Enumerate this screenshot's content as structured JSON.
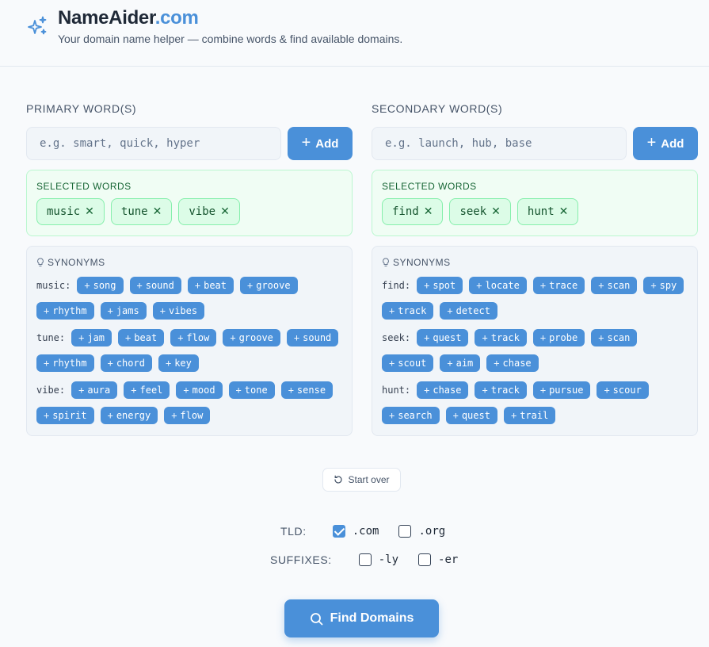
{
  "header": {
    "brand_name": "NameAider",
    "brand_tld": ".com",
    "tagline": "Your domain name helper — combine words & find available domains.",
    "logo_icon": "sparkles-icon"
  },
  "primary": {
    "label": "PRIMARY WORD(S)",
    "placeholder": "e.g. smart, quick, hyper",
    "add_label": "Add",
    "selected_label": "SELECTED WORDS",
    "selected": [
      "music",
      "tune",
      "vibe"
    ],
    "synonyms_label": "SYNONYMS",
    "synonyms": [
      {
        "key": "music:",
        "words": [
          "song",
          "sound",
          "beat",
          "groove",
          "rhythm",
          "jams",
          "vibes"
        ]
      },
      {
        "key": "tune:",
        "words": [
          "jam",
          "beat",
          "flow",
          "groove",
          "sound",
          "rhythm",
          "chord",
          "key"
        ]
      },
      {
        "key": "vibe:",
        "words": [
          "aura",
          "feel",
          "mood",
          "tone",
          "sense",
          "spirit",
          "energy",
          "flow"
        ]
      }
    ]
  },
  "secondary": {
    "label": "SECONDARY WORD(S)",
    "placeholder": "e.g. launch, hub, base",
    "add_label": "Add",
    "selected_label": "SELECTED WORDS",
    "selected": [
      "find",
      "seek",
      "hunt"
    ],
    "synonyms_label": "SYNONYMS",
    "synonyms": [
      {
        "key": "find:",
        "words": [
          "spot",
          "locate",
          "trace",
          "scan",
          "spy",
          "track",
          "detect"
        ]
      },
      {
        "key": "seek:",
        "words": [
          "quest",
          "track",
          "probe",
          "scan",
          "scout",
          "aim",
          "chase"
        ]
      },
      {
        "key": "hunt:",
        "words": [
          "chase",
          "track",
          "pursue",
          "scour",
          "search",
          "quest",
          "trail"
        ]
      }
    ]
  },
  "start_over_label": "Start over",
  "tld": {
    "label": "TLD:",
    "options": [
      {
        "text": ".com",
        "checked": true
      },
      {
        "text": ".org",
        "checked": false
      }
    ]
  },
  "suffixes": {
    "label": "SUFFIXES:",
    "options": [
      {
        "text": "-ly",
        "checked": false
      },
      {
        "text": "-er",
        "checked": false
      }
    ]
  },
  "find_label": "Find Domains",
  "colors": {
    "accent": "#4a90d9",
    "selected_bg": "#dcfce7",
    "selected_border": "#86efac"
  }
}
